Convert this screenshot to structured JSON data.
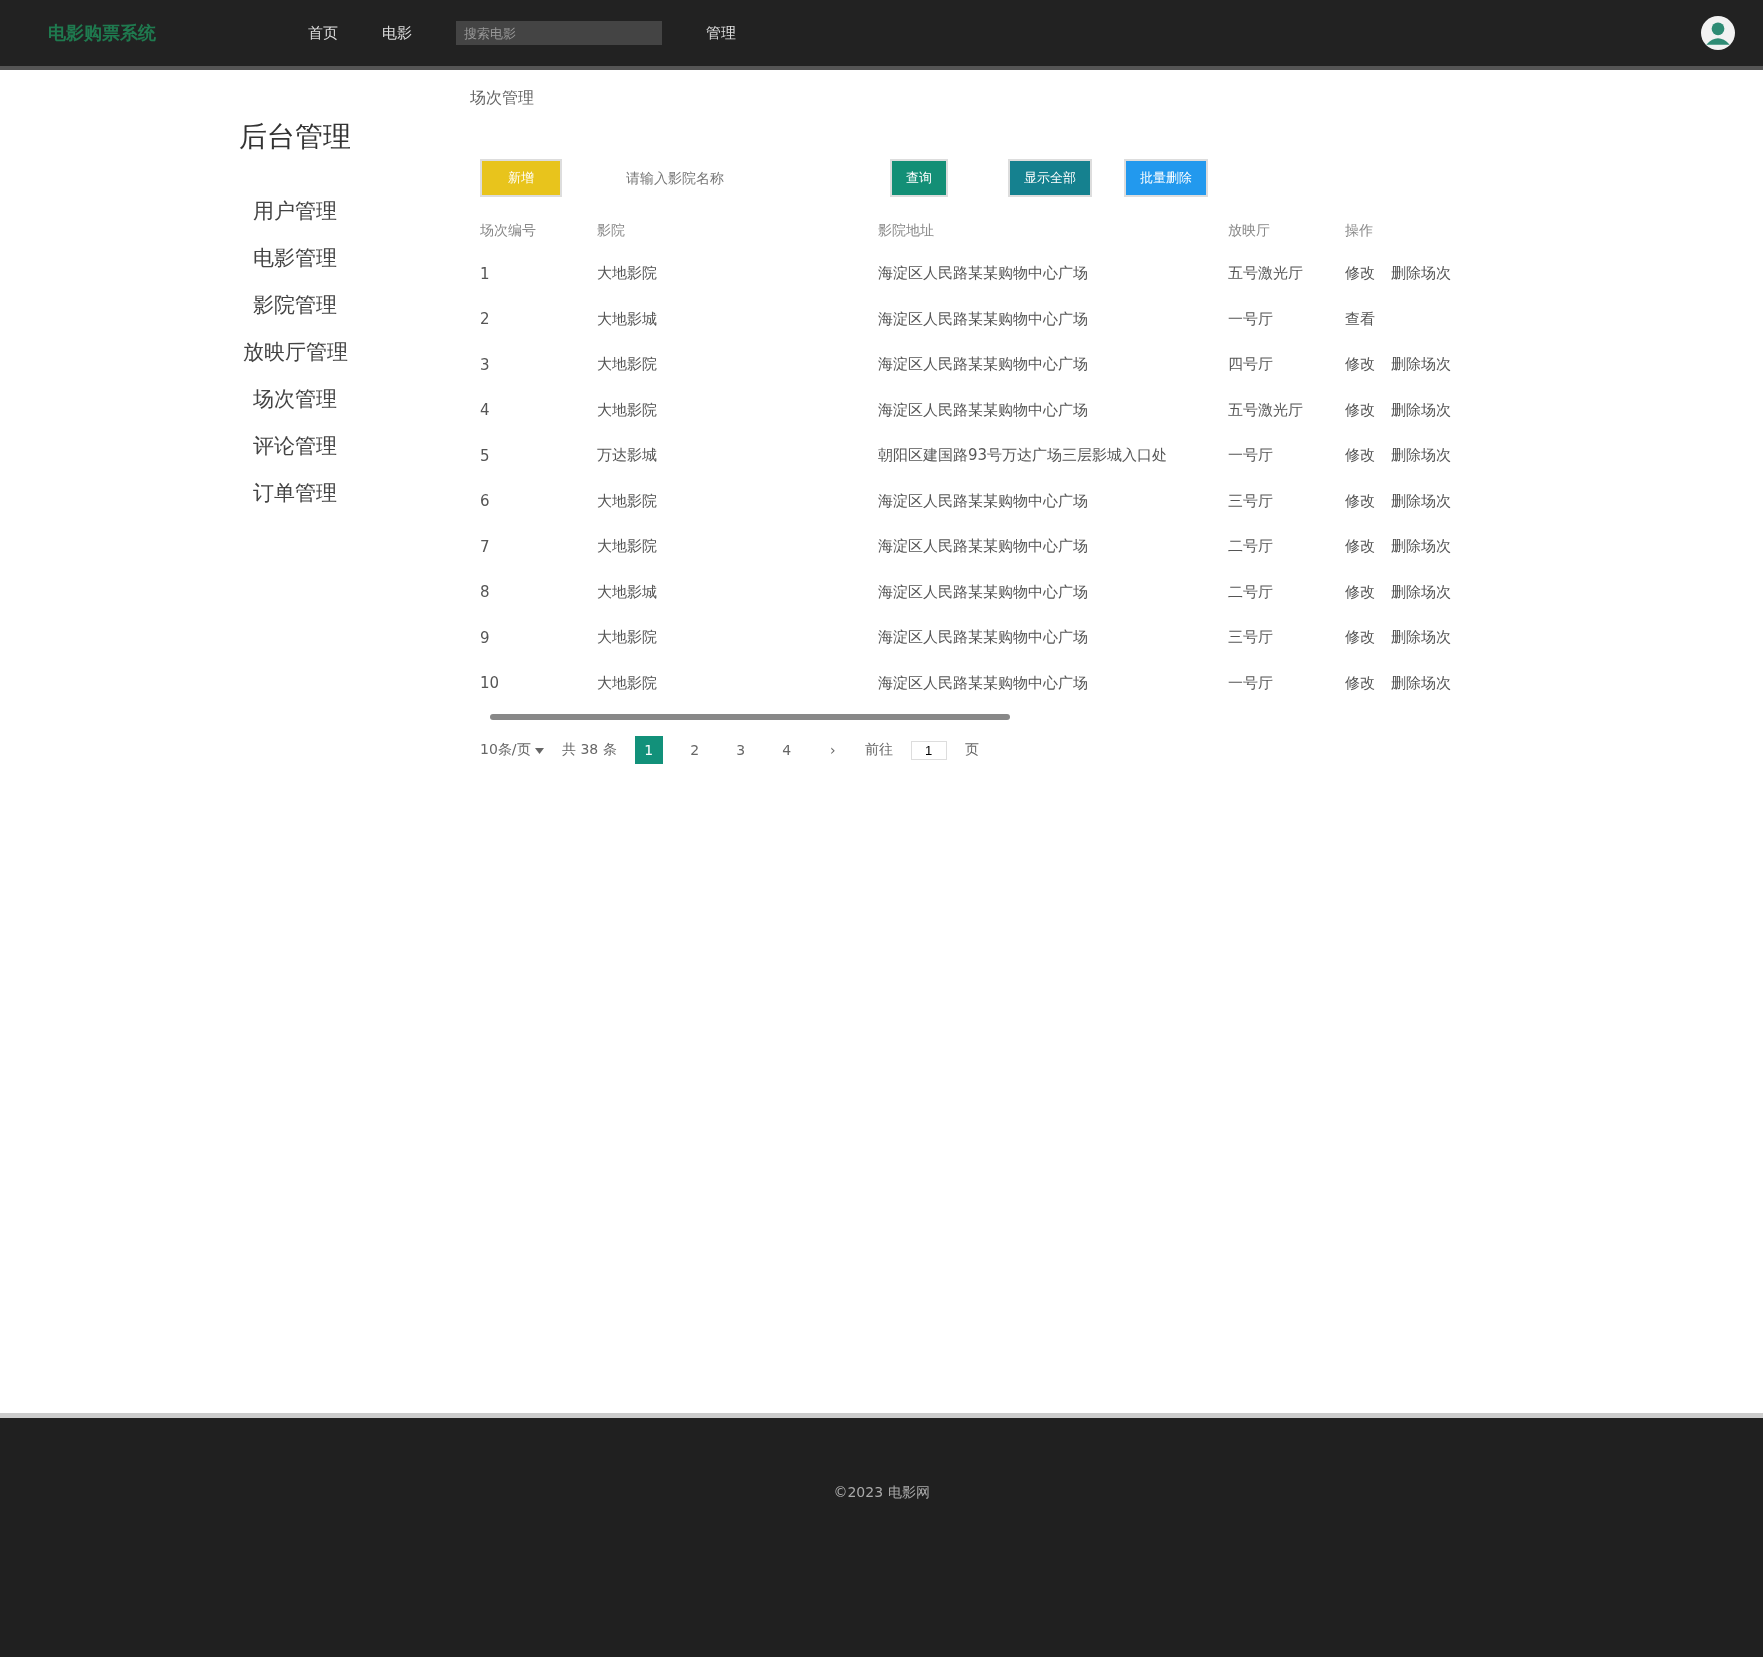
{
  "header": {
    "logo": "电影购票系统",
    "nav": [
      "首页",
      "电影"
    ],
    "search": {
      "placeholder": "搜索电影"
    },
    "nav_after": [
      "管理"
    ]
  },
  "sidebar": {
    "title": "后台管理",
    "items": [
      "用户管理",
      "电影管理",
      "影院管理",
      "放映厅管理",
      "场次管理",
      "评论管理",
      "订单管理"
    ]
  },
  "breadcrumb": "场次管理",
  "toolbar": {
    "add_button": "新增",
    "search": {
      "placeholder": "请输入影院名称"
    },
    "search_button": "查询",
    "show_all_button": "显示全部",
    "delete_button": "批量删除"
  },
  "table": {
    "columns": [
      "场次编号",
      "影院",
      "影院地址",
      "放映厅",
      "操作"
    ],
    "rows": [
      {
        "cells": [
          "1",
          "大地影院",
          "海淀区人民路某某购物中心广场",
          "五号激光厅"
        ],
        "actions": [
          "修改",
          "删除场次"
        ]
      },
      {
        "cells": [
          "2",
          "大地影城",
          "海淀区人民路某某购物中心广场",
          "一号厅"
        ],
        "actions": [
          "查看"
        ]
      },
      {
        "cells": [
          "3",
          "大地影院",
          "海淀区人民路某某购物中心广场",
          "四号厅"
        ],
        "actions": [
          "修改",
          "删除场次"
        ]
      },
      {
        "cells": [
          "4",
          "大地影院",
          "海淀区人民路某某购物中心广场",
          "五号激光厅"
        ],
        "actions": [
          "修改",
          "删除场次"
        ]
      },
      {
        "cells": [
          "5",
          "万达影城",
          "朝阳区建国路93号万达广场三层影城入口处",
          "一号厅"
        ],
        "actions": [
          "修改",
          "删除场次"
        ]
      },
      {
        "cells": [
          "6",
          "大地影院",
          "海淀区人民路某某购物中心广场",
          "三号厅"
        ],
        "actions": [
          "修改",
          "删除场次"
        ]
      },
      {
        "cells": [
          "7",
          "大地影院",
          "海淀区人民路某某购物中心广场",
          "二号厅"
        ],
        "actions": [
          "修改",
          "删除场次"
        ]
      },
      {
        "cells": [
          "8",
          "大地影城",
          "海淀区人民路某某购物中心广场",
          "二号厅"
        ],
        "actions": [
          "修改",
          "删除场次"
        ]
      },
      {
        "cells": [
          "9",
          "大地影院",
          "海淀区人民路某某购物中心广场",
          "三号厅"
        ],
        "actions": [
          "修改",
          "删除场次"
        ]
      },
      {
        "cells": [
          "10",
          "大地影院",
          "海淀区人民路某某购物中心广场",
          "一号厅"
        ],
        "actions": [
          "修改",
          "删除场次"
        ]
      }
    ]
  },
  "pagination": {
    "page_size": "10条/页",
    "total": "共 38 条",
    "pages": [
      {
        "label": "1",
        "selected": true
      },
      {
        "label": "2",
        "selected": false
      },
      {
        "label": "3",
        "selected": false
      },
      {
        "label": "4",
        "selected": false
      }
    ],
    "next": "›",
    "goto": "前往",
    "goto_value": "1",
    "goto_suffix": "页"
  },
  "footer": {
    "text": "©2023 电影网"
  }
}
